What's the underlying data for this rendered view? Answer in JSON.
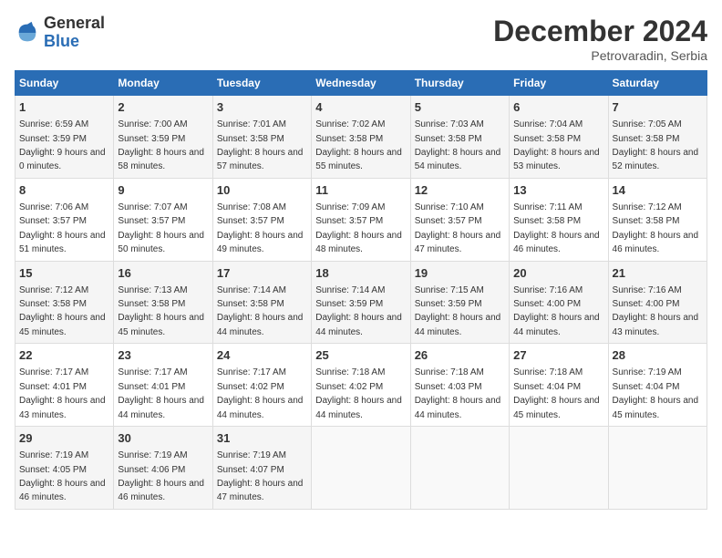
{
  "logo": {
    "general": "General",
    "blue": "Blue"
  },
  "title": "December 2024",
  "subtitle": "Petrovaradin, Serbia",
  "days_of_week": [
    "Sunday",
    "Monday",
    "Tuesday",
    "Wednesday",
    "Thursday",
    "Friday",
    "Saturday"
  ],
  "weeks": [
    [
      {
        "day": "1",
        "sunrise": "6:59 AM",
        "sunset": "3:59 PM",
        "daylight": "9 hours and 0 minutes."
      },
      {
        "day": "2",
        "sunrise": "7:00 AM",
        "sunset": "3:59 PM",
        "daylight": "8 hours and 58 minutes."
      },
      {
        "day": "3",
        "sunrise": "7:01 AM",
        "sunset": "3:58 PM",
        "daylight": "8 hours and 57 minutes."
      },
      {
        "day": "4",
        "sunrise": "7:02 AM",
        "sunset": "3:58 PM",
        "daylight": "8 hours and 55 minutes."
      },
      {
        "day": "5",
        "sunrise": "7:03 AM",
        "sunset": "3:58 PM",
        "daylight": "8 hours and 54 minutes."
      },
      {
        "day": "6",
        "sunrise": "7:04 AM",
        "sunset": "3:58 PM",
        "daylight": "8 hours and 53 minutes."
      },
      {
        "day": "7",
        "sunrise": "7:05 AM",
        "sunset": "3:58 PM",
        "daylight": "8 hours and 52 minutes."
      }
    ],
    [
      {
        "day": "8",
        "sunrise": "7:06 AM",
        "sunset": "3:57 PM",
        "daylight": "8 hours and 51 minutes."
      },
      {
        "day": "9",
        "sunrise": "7:07 AM",
        "sunset": "3:57 PM",
        "daylight": "8 hours and 50 minutes."
      },
      {
        "day": "10",
        "sunrise": "7:08 AM",
        "sunset": "3:57 PM",
        "daylight": "8 hours and 49 minutes."
      },
      {
        "day": "11",
        "sunrise": "7:09 AM",
        "sunset": "3:57 PM",
        "daylight": "8 hours and 48 minutes."
      },
      {
        "day": "12",
        "sunrise": "7:10 AM",
        "sunset": "3:57 PM",
        "daylight": "8 hours and 47 minutes."
      },
      {
        "day": "13",
        "sunrise": "7:11 AM",
        "sunset": "3:58 PM",
        "daylight": "8 hours and 46 minutes."
      },
      {
        "day": "14",
        "sunrise": "7:12 AM",
        "sunset": "3:58 PM",
        "daylight": "8 hours and 46 minutes."
      }
    ],
    [
      {
        "day": "15",
        "sunrise": "7:12 AM",
        "sunset": "3:58 PM",
        "daylight": "8 hours and 45 minutes."
      },
      {
        "day": "16",
        "sunrise": "7:13 AM",
        "sunset": "3:58 PM",
        "daylight": "8 hours and 45 minutes."
      },
      {
        "day": "17",
        "sunrise": "7:14 AM",
        "sunset": "3:58 PM",
        "daylight": "8 hours and 44 minutes."
      },
      {
        "day": "18",
        "sunrise": "7:14 AM",
        "sunset": "3:59 PM",
        "daylight": "8 hours and 44 minutes."
      },
      {
        "day": "19",
        "sunrise": "7:15 AM",
        "sunset": "3:59 PM",
        "daylight": "8 hours and 44 minutes."
      },
      {
        "day": "20",
        "sunrise": "7:16 AM",
        "sunset": "4:00 PM",
        "daylight": "8 hours and 44 minutes."
      },
      {
        "day": "21",
        "sunrise": "7:16 AM",
        "sunset": "4:00 PM",
        "daylight": "8 hours and 43 minutes."
      }
    ],
    [
      {
        "day": "22",
        "sunrise": "7:17 AM",
        "sunset": "4:01 PM",
        "daylight": "8 hours and 43 minutes."
      },
      {
        "day": "23",
        "sunrise": "7:17 AM",
        "sunset": "4:01 PM",
        "daylight": "8 hours and 44 minutes."
      },
      {
        "day": "24",
        "sunrise": "7:17 AM",
        "sunset": "4:02 PM",
        "daylight": "8 hours and 44 minutes."
      },
      {
        "day": "25",
        "sunrise": "7:18 AM",
        "sunset": "4:02 PM",
        "daylight": "8 hours and 44 minutes."
      },
      {
        "day": "26",
        "sunrise": "7:18 AM",
        "sunset": "4:03 PM",
        "daylight": "8 hours and 44 minutes."
      },
      {
        "day": "27",
        "sunrise": "7:18 AM",
        "sunset": "4:04 PM",
        "daylight": "8 hours and 45 minutes."
      },
      {
        "day": "28",
        "sunrise": "7:19 AM",
        "sunset": "4:04 PM",
        "daylight": "8 hours and 45 minutes."
      }
    ],
    [
      {
        "day": "29",
        "sunrise": "7:19 AM",
        "sunset": "4:05 PM",
        "daylight": "8 hours and 46 minutes."
      },
      {
        "day": "30",
        "sunrise": "7:19 AM",
        "sunset": "4:06 PM",
        "daylight": "8 hours and 46 minutes."
      },
      {
        "day": "31",
        "sunrise": "7:19 AM",
        "sunset": "4:07 PM",
        "daylight": "8 hours and 47 minutes."
      },
      null,
      null,
      null,
      null
    ]
  ],
  "labels": {
    "sunrise": "Sunrise:",
    "sunset": "Sunset:",
    "daylight": "Daylight:"
  }
}
